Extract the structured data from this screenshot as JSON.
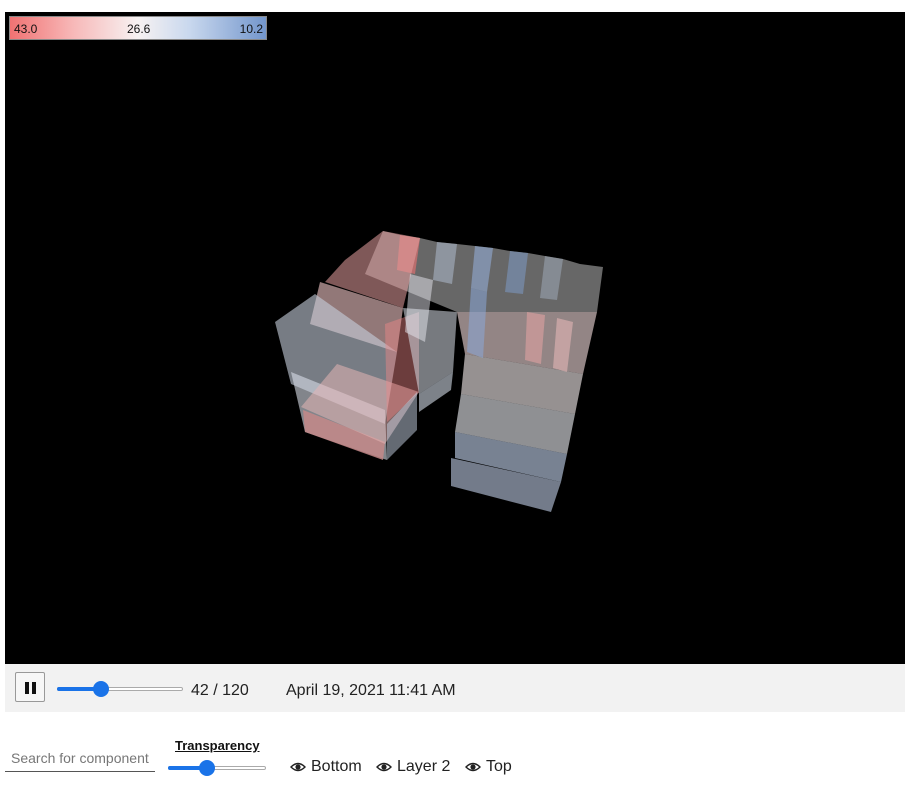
{
  "legend": {
    "max_label": "43.0",
    "mid_label": "26.6",
    "min_label": "10.2",
    "colors": {
      "hot": "#f07272",
      "neutral": "#f7f2f2",
      "cold": "#7396cc"
    }
  },
  "playback": {
    "icon": "pause-icon",
    "frame": "42 / 120",
    "frame_current": 42,
    "frame_total": 120,
    "timestamp": "April 19, 2021 11:41 AM"
  },
  "search": {
    "placeholder": "Search for component",
    "value": ""
  },
  "transparency": {
    "label": "Transparency",
    "level": 0.4
  },
  "layers": [
    {
      "label": "Bottom",
      "icon": "eye-icon"
    },
    {
      "label": "Layer 2",
      "icon": "eye-icon"
    },
    {
      "label": "Top",
      "icon": "eye-icon"
    }
  ],
  "colors": {
    "viewer_bg": "#000000",
    "controls_bg": "#f2f2f2",
    "accent": "#1a73e8"
  }
}
